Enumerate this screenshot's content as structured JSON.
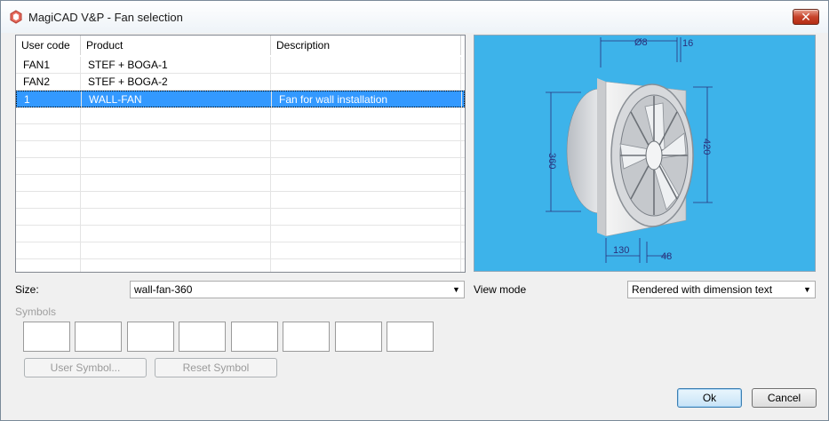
{
  "window": {
    "title": "MagiCAD V&P - Fan selection",
    "close_label": "✕",
    "accent_color": "#c7432b"
  },
  "table": {
    "columns": [
      "User code",
      "Product",
      "Description"
    ],
    "rows": [
      {
        "user_code": "FAN1",
        "product": "STEF + BOGA-1",
        "description": ""
      },
      {
        "user_code": "FAN2",
        "product": "STEF + BOGA-2",
        "description": ""
      },
      {
        "user_code": "1",
        "product": "WALL-FAN",
        "description": "Fan for wall installation"
      }
    ],
    "selected_index": 2
  },
  "preview": {
    "background_color": "#3db3ea",
    "dimensions": [
      "Ø8",
      "16",
      "360",
      "420",
      "130",
      "48"
    ]
  },
  "size": {
    "label": "Size:",
    "value": "wall-fan-360"
  },
  "view_mode": {
    "label": "View mode",
    "value": "Rendered with dimension text"
  },
  "symbols": {
    "label": "Symbols",
    "box_count": 8,
    "user_symbol_label": "User Symbol...",
    "reset_symbol_label": "Reset Symbol"
  },
  "footer": {
    "ok_label": "Ok",
    "cancel_label": "Cancel"
  }
}
